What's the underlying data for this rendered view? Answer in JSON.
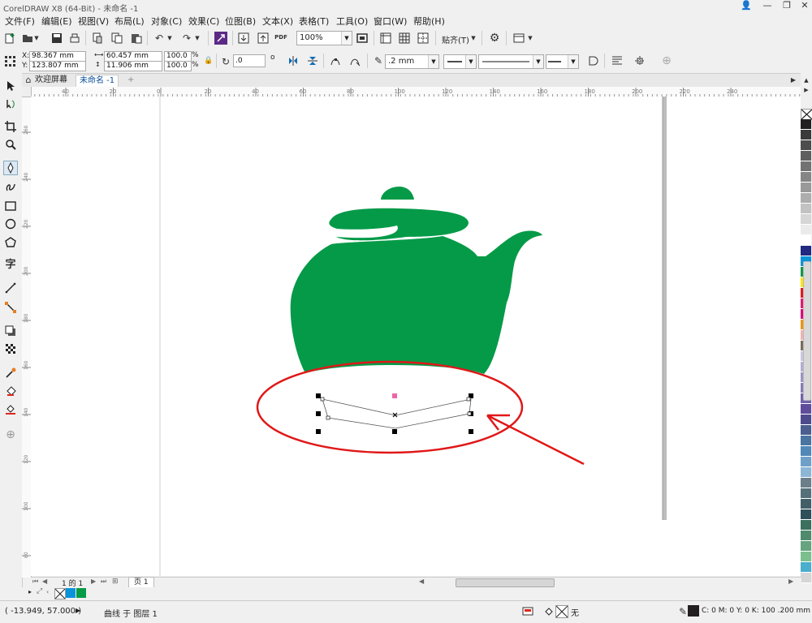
{
  "title_bar": {
    "title": "CorelDRAW X8 (64-Bit) - 未命名 -1",
    "minimize": "—",
    "restore": "❐",
    "close": "✕"
  },
  "menu": [
    "文件(F)",
    "编辑(E)",
    "视图(V)",
    "布局(L)",
    "对象(C)",
    "效果(C)",
    "位图(B)",
    "文本(X)",
    "表格(T)",
    "工具(O)",
    "窗口(W)",
    "帮助(H)"
  ],
  "standard_toolbar": {
    "zoom_value": "100%",
    "snap_label": "贴齐(T)",
    "pdf_label": "PDF"
  },
  "property_bar": {
    "x_label": "X:",
    "x_value": "98.367 mm",
    "y_label": "Y:",
    "y_value": "123.807 mm",
    "width_value": "60.457 mm",
    "height_value": "11.906 mm",
    "scale_x": "100.0",
    "scale_y": "100.0",
    "percent": "%",
    "rotation_value": ".0",
    "degree": "o",
    "outline_width": ".2 mm"
  },
  "tabs": {
    "welcome": "欢迎屏幕",
    "document": "未命名 -1",
    "add": "+"
  },
  "rulers": {
    "horizontal": [
      "40",
      "20",
      "0",
      "20",
      "40",
      "60",
      "80",
      "100",
      "120",
      "140",
      "160",
      "180",
      "200",
      "220",
      "240"
    ],
    "vertical": [
      "260",
      "240",
      "220",
      "200",
      "180",
      "160",
      "140",
      "120",
      "100",
      "80",
      "60",
      "40"
    ]
  },
  "doc_nav": {
    "page_info": "1 的 1",
    "page_tab": "页 1"
  },
  "status": {
    "coords": "( -13.949, 57.000 )",
    "object_info": "曲线 于 图层 1",
    "fill_none": "无",
    "outline_info": "C: 0 M: 0 Y: 0 K: 100  .200 mm"
  },
  "colors": {
    "teapot": "#059a48",
    "annotation": "#e01818",
    "palette": [
      "#231f20",
      "#3a3a3a",
      "#4d4d4d",
      "#5f5f5f",
      "#727272",
      "#858585",
      "#999999",
      "#adadad",
      "#c2c2c2",
      "#d6d6d6",
      "#ebebeb",
      "#ffffff",
      "#1f2a80",
      "#0a93d8",
      "#079a47",
      "#ffe500",
      "#e5191d",
      "#e5196e",
      "#e1007a",
      "#f29400",
      "#f4b2b1",
      "#7c6c5d",
      "#c9c7e2",
      "#b4add2",
      "#9d94c5",
      "#877bb9",
      "#7262ab",
      "#5f4d9c",
      "#4e4a8e",
      "#4a5f8f",
      "#4a74a2",
      "#5188b8",
      "#6fa0c9",
      "#8db6d6",
      "#6a7f8a",
      "#56707a",
      "#425f69",
      "#2f505b",
      "#3b6f5e",
      "#4f8a6d",
      "#65a47e",
      "#7cbf8f",
      "#4aaecc",
      "#d6d6d6"
    ]
  }
}
